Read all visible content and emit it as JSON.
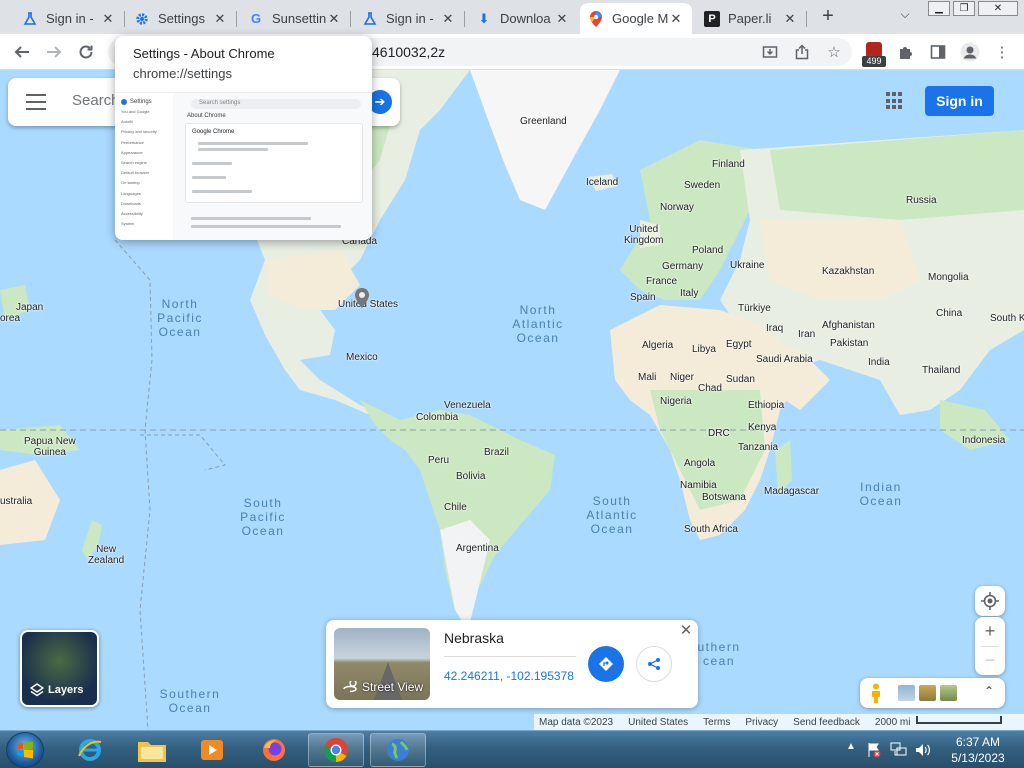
{
  "tabs": [
    {
      "label": "Sign in -",
      "icon": "flask-icon",
      "active": false
    },
    {
      "label": "Settings",
      "icon": "gear-icon",
      "active": false
    },
    {
      "label": "Sunsettin",
      "icon": "google-g-icon",
      "active": false
    },
    {
      "label": "Sign in -",
      "icon": "flask-icon",
      "active": false
    },
    {
      "label": "Downloa",
      "icon": "download-icon",
      "active": false
    },
    {
      "label": "Google M",
      "icon": "maps-pin-icon",
      "active": true
    },
    {
      "label": "Paper.li",
      "icon": "paperli-icon",
      "active": false
    }
  ],
  "toolbar": {
    "url_visible": "4610032,2z",
    "extension_badge": "499"
  },
  "hovercard": {
    "title": "Settings - About Chrome",
    "url": "chrome://settings",
    "thumb_heading": "Settings",
    "thumb_section": "About Chrome",
    "thumb_card_title": "Google Chrome",
    "thumb_search": "Search settings",
    "thumb_nav": [
      "You and Google",
      "Autofill",
      "Privacy and security",
      "Performance",
      "Appearance",
      "Search engine",
      "Default browser",
      "On startup",
      "Languages",
      "Downloads",
      "Accessibility",
      "System"
    ]
  },
  "search": {
    "placeholder": "Search"
  },
  "signin_label": "Sign in",
  "map_labels": {
    "greenland": "Greenland",
    "iceland": "Iceland",
    "finland": "Finland",
    "sweden": "Sweden",
    "norway": "Norway",
    "russia": "Russia",
    "uk": "United\nKingdom",
    "poland": "Poland",
    "germany": "Germany",
    "ukraine": "Ukraine",
    "france": "France",
    "spain": "Spain",
    "italy": "Italy",
    "kazakhstan": "Kazakhstan",
    "mongolia": "Mongolia",
    "turkiye": "Türkiye",
    "china": "China",
    "southkorea": "South Ko",
    "japan": "Japan",
    "korea_left": "orea",
    "iraq": "Iraq",
    "iran": "Iran",
    "afghanistan": "Afghanistan",
    "pakistan": "Pakistan",
    "india": "India",
    "thailand": "Thailand",
    "saudi": "Saudi Arabia",
    "algeria": "Algeria",
    "libya": "Libya",
    "egypt": "Egypt",
    "mali": "Mali",
    "niger": "Niger",
    "chad": "Chad",
    "sudan": "Sudan",
    "nigeria": "Nigeria",
    "ethiopia": "Ethiopia",
    "drc": "DRC",
    "kenya": "Kenya",
    "tanzania": "Tanzania",
    "angola": "Angola",
    "namibia": "Namibia",
    "botswana": "Botswana",
    "southafrica": "South Africa",
    "madagascar": "Madagascar",
    "indonesia": "Indonesia",
    "png": "Papua New\nGuinea",
    "australia": "ustralia",
    "newzealand": "New\nZealand",
    "canada": "Canada",
    "usa": "United States",
    "mexico": "Mexico",
    "venezuela": "Venezuela",
    "colombia": "Colombia",
    "peru": "Peru",
    "brazil": "Brazil",
    "bolivia": "Bolivia",
    "chile": "Chile",
    "argentina": "Argentina"
  },
  "oceans": {
    "north_pacific": "North\nPacific\nOcean",
    "north_atlantic": "North\nAtlantic\nOcean",
    "south_pacific": "South\nPacific\nOcean",
    "south_atlantic": "South\nAtlantic\nOcean",
    "indian": "Indian\nOcean",
    "southern_left": "Southern\nOcean",
    "southern_right": "uthern\ncean"
  },
  "layers_label": "Layers",
  "info_card": {
    "place": "Nebraska",
    "coords": "42.246211, -102.195378",
    "street_view_label": "Street View"
  },
  "attribution": {
    "map_data": "Map data ©2023",
    "region": "United States",
    "terms": "Terms",
    "privacy": "Privacy",
    "feedback": "Send feedback",
    "scale": "2000 mi"
  },
  "clock": {
    "time": "6:37 AM",
    "date": "5/13/2023"
  },
  "colors": {
    "land": "#f1f3f4",
    "forest": "#cce8c2",
    "desert": "#f4ecd8",
    "water": "#aadaff",
    "accent": "#1a73e8"
  }
}
